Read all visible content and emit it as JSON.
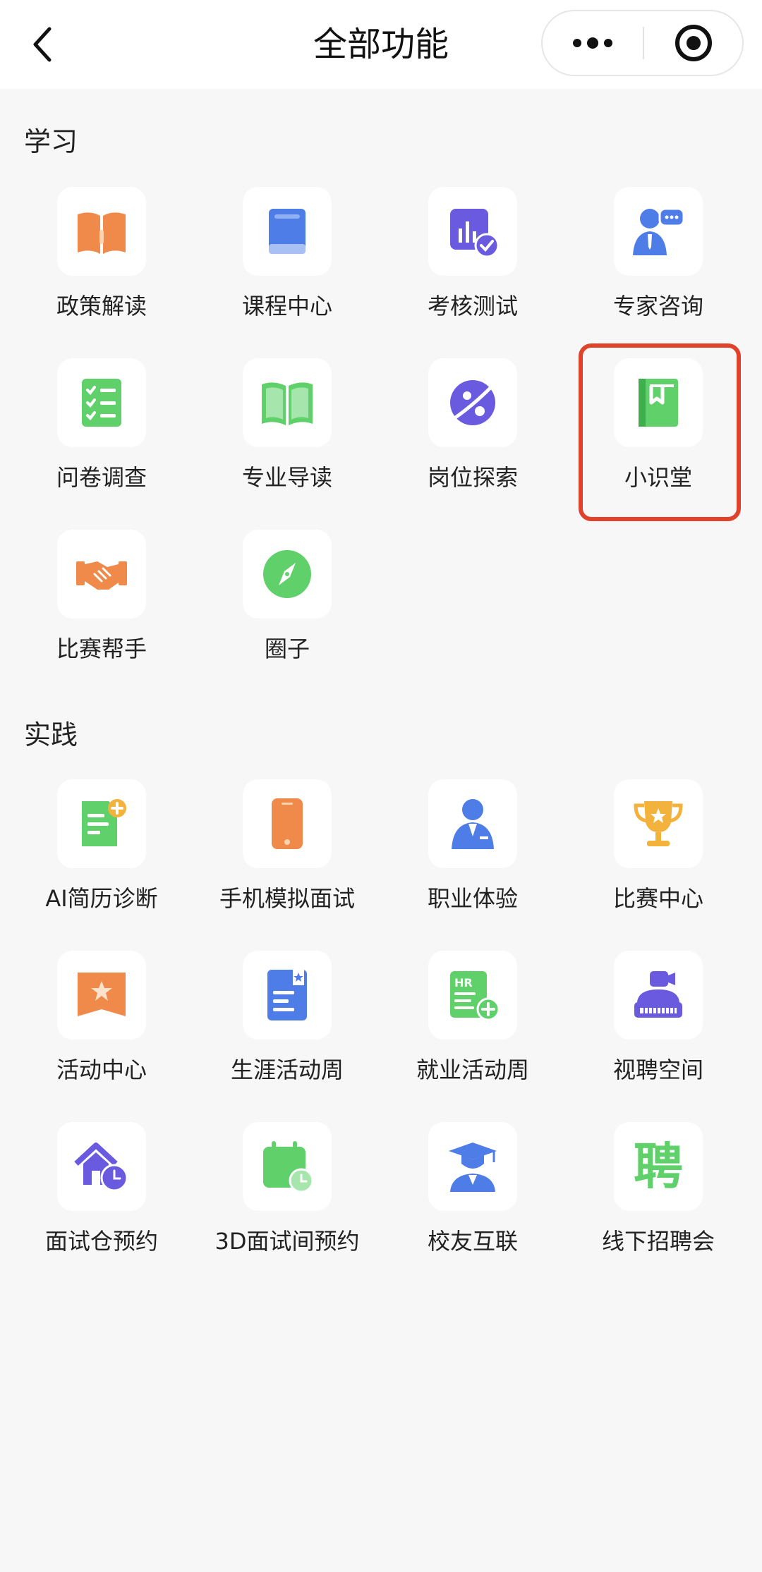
{
  "header": {
    "title": "全部功能",
    "back_icon": "chevron-left-icon",
    "more_icon": "more-dots-icon",
    "close_icon": "target-close-icon"
  },
  "sections": [
    {
      "title": "学习",
      "items": [
        {
          "label": "政策解读",
          "icon": "open-book-icon",
          "color": "#ef8a4a"
        },
        {
          "label": "课程中心",
          "icon": "closed-book-icon",
          "color": "#4f7de8"
        },
        {
          "label": "考核测试",
          "icon": "chart-check-icon",
          "color": "#6a5ae0"
        },
        {
          "label": "专家咨询",
          "icon": "consultant-icon",
          "color": "#4f7de8"
        },
        {
          "label": "问卷调查",
          "icon": "checklist-icon",
          "color": "#5fd06a"
        },
        {
          "label": "专业导读",
          "icon": "reading-book-icon",
          "color": "#5fd06a"
        },
        {
          "label": "岗位探索",
          "icon": "planet-icon",
          "color": "#6a5ae0"
        },
        {
          "label": "小识堂",
          "icon": "bookmark-book-icon",
          "color": "#5fd06a"
        },
        {
          "label": "比赛帮手",
          "icon": "handshake-icon",
          "color": "#ef8a4a"
        },
        {
          "label": "圈子",
          "icon": "compass-icon",
          "color": "#5fd06a"
        }
      ]
    },
    {
      "title": "实践",
      "items": [
        {
          "label": "AI简历诊断",
          "icon": "resume-plus-icon",
          "color": "#5fd06a"
        },
        {
          "label": "手机模拟面试",
          "icon": "phone-icon",
          "color": "#ef8a4a"
        },
        {
          "label": "职业体验",
          "icon": "professional-icon",
          "color": "#4f7de8"
        },
        {
          "label": "比赛中心",
          "icon": "trophy-icon",
          "color": "#f3b23c"
        },
        {
          "label": "活动中心",
          "icon": "star-ribbon-icon",
          "color": "#ef8a4a"
        },
        {
          "label": "生涯活动周",
          "icon": "document-badge-icon",
          "color": "#4f7de8"
        },
        {
          "label": "就业活动周",
          "icon": "hr-document-icon",
          "color": "#5fd06a"
        },
        {
          "label": "视聘空间",
          "icon": "video-camera-icon",
          "color": "#6a5ae0"
        },
        {
          "label": "面试仓预约",
          "icon": "house-clock-icon",
          "color": "#6a5ae0"
        },
        {
          "label": "3D面试间预约",
          "icon": "calendar-clock-icon",
          "color": "#5fd06a"
        },
        {
          "label": "校友互联",
          "icon": "graduate-icon",
          "color": "#4f7de8"
        },
        {
          "label": "线下招聘会",
          "icon": "pin-character-icon",
          "color": "#5fd06a",
          "glyph": "聘"
        }
      ]
    }
  ]
}
